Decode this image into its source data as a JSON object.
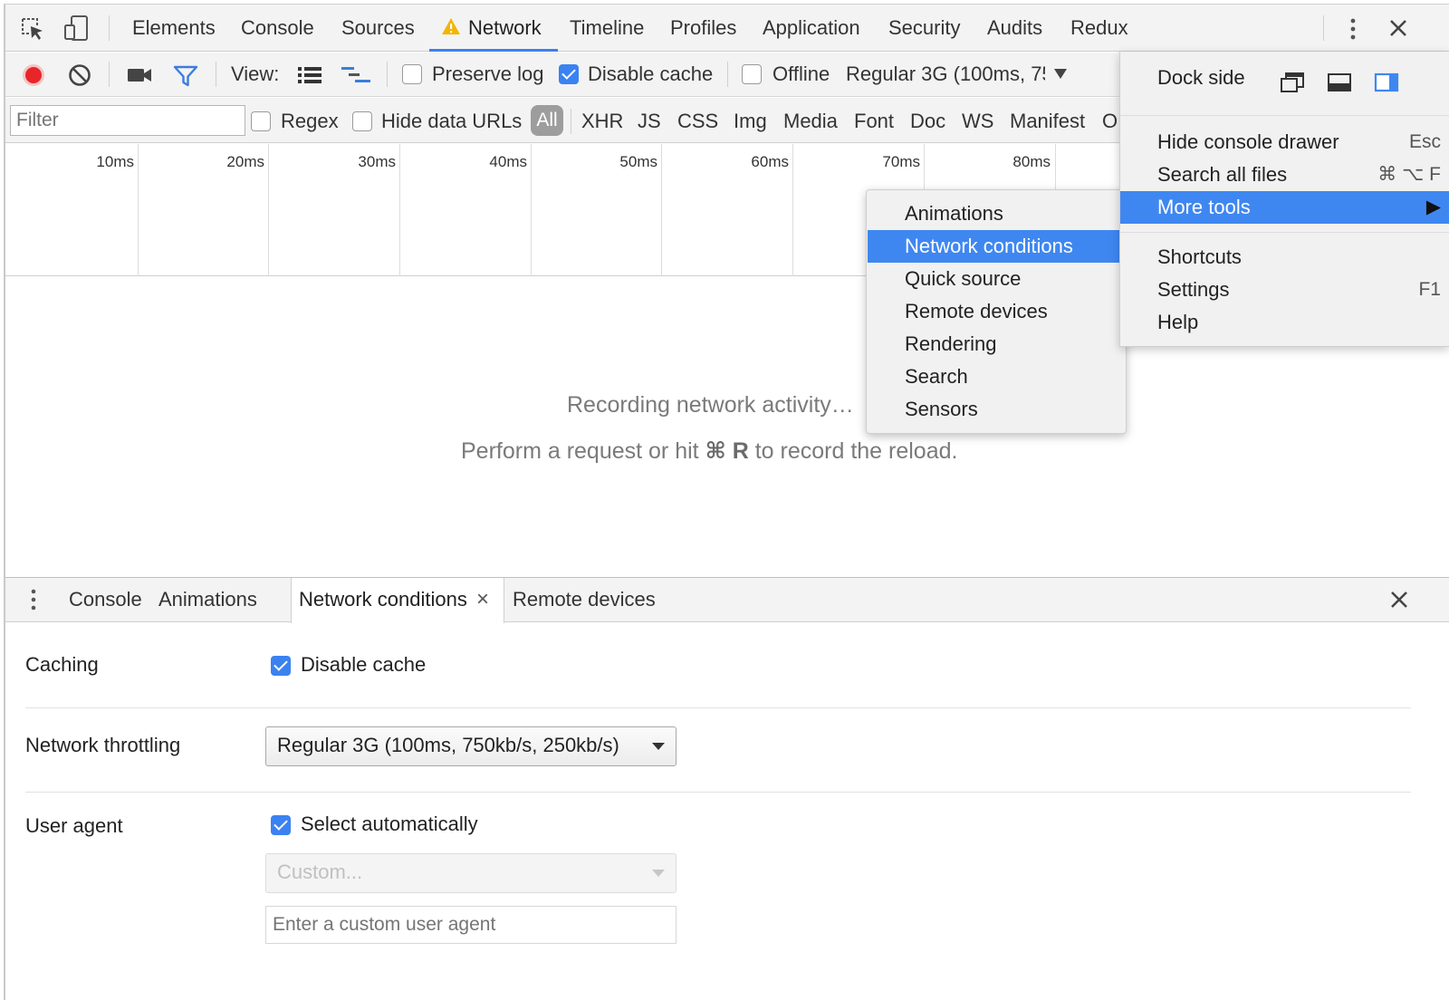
{
  "main_tabs": [
    {
      "label": "Elements"
    },
    {
      "label": "Console"
    },
    {
      "label": "Sources"
    },
    {
      "label": "Network"
    },
    {
      "label": "Timeline"
    },
    {
      "label": "Profiles"
    },
    {
      "label": "Application"
    },
    {
      "label": "Security"
    },
    {
      "label": "Audits"
    },
    {
      "label": "Redux"
    }
  ],
  "toolbar": {
    "view_label": "View:",
    "preserve_log": {
      "label": "Preserve log",
      "checked": false
    },
    "disable_cache": {
      "label": "Disable cache",
      "checked": true
    },
    "offline": {
      "label": "Offline",
      "checked": false
    },
    "throttle_value": "Regular 3G (100ms, 75"
  },
  "filter": {
    "placeholder": "Filter",
    "regex_label": "Regex",
    "hide_data_urls_label": "Hide data URLs",
    "types": [
      "All",
      "XHR",
      "JS",
      "CSS",
      "Img",
      "Media",
      "Font",
      "Doc",
      "WS",
      "Manifest",
      "O"
    ]
  },
  "timeline": {
    "ticks": [
      "10ms",
      "20ms",
      "30ms",
      "40ms",
      "50ms",
      "60ms",
      "70ms",
      "80ms"
    ]
  },
  "empty_state": {
    "line1": "Recording network activity…",
    "line2_prefix": "Perform a request or hit ",
    "line2_shortcut": "⌘ R",
    "line2_suffix": " to record the reload."
  },
  "main_menu": {
    "dock_side_label": "Dock side",
    "items": [
      {
        "label": "Hide console drawer",
        "shortcut": "Esc"
      },
      {
        "label": "Search all files",
        "shortcut": "⌘ ⌥ F"
      },
      {
        "label": "More tools",
        "shortcut": "▶"
      },
      {
        "label": "Shortcuts",
        "shortcut": ""
      },
      {
        "label": "Settings",
        "shortcut": "F1"
      },
      {
        "label": "Help",
        "shortcut": ""
      }
    ]
  },
  "more_tools_menu": {
    "items": [
      "Animations",
      "Network conditions",
      "Quick source",
      "Remote devices",
      "Rendering",
      "Search",
      "Sensors"
    ],
    "highlighted": "Network conditions"
  },
  "drawer": {
    "tabs": [
      "Console",
      "Animations",
      "Network conditions",
      "Remote devices"
    ],
    "active_tab": "Network conditions",
    "close_glyph": "×"
  },
  "network_conditions": {
    "caching_label": "Caching",
    "disable_cache_label": "Disable cache",
    "disable_cache_checked": true,
    "throttling_label": "Network throttling",
    "throttling_value": "Regular 3G (100ms, 750kb/s, 250kb/s)",
    "user_agent_label": "User agent",
    "select_automatically_label": "Select automatically",
    "select_automatically_checked": true,
    "custom_select_value": "Custom...",
    "custom_ua_placeholder": "Enter a custom user agent"
  },
  "colors": {
    "accent": "#3f87f0",
    "record": "#e8262a",
    "warning": "#f4b400"
  }
}
